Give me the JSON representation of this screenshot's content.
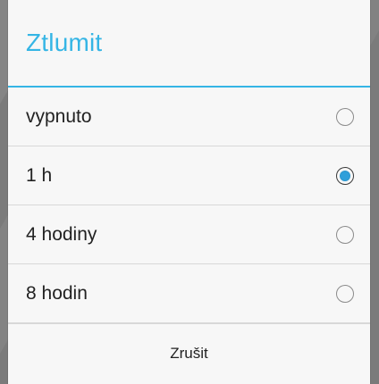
{
  "dialog": {
    "title": "Ztlumit",
    "options": [
      {
        "label": "vypnuto",
        "selected": false
      },
      {
        "label": "1 h",
        "selected": true
      },
      {
        "label": "4 hodiny",
        "selected": false
      },
      {
        "label": "8 hodin",
        "selected": false
      }
    ],
    "cancel_label": "Zrušit"
  },
  "colors": {
    "accent": "#35b5e5",
    "radio_fill": "#2f9fda",
    "surface": "#f7f7f7",
    "divider": "#d8d8d8"
  }
}
